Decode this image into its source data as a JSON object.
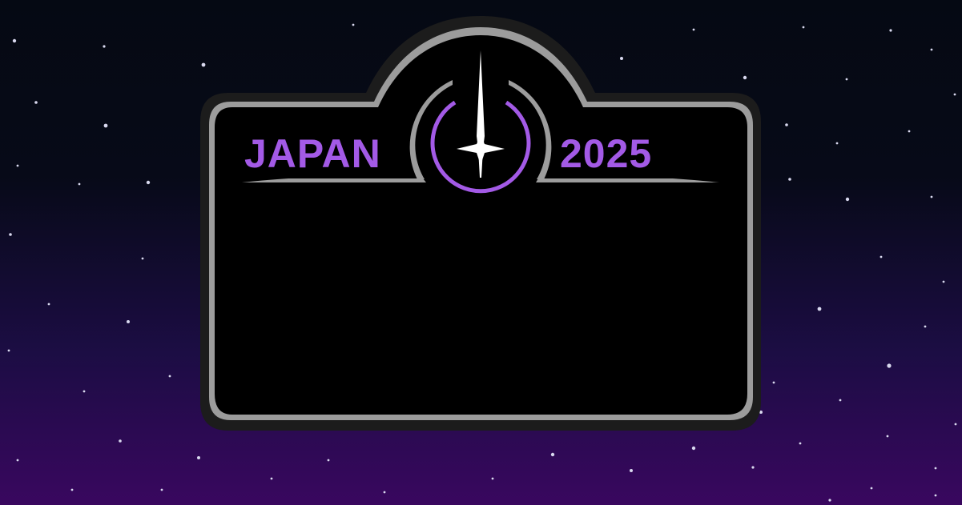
{
  "badge": {
    "left_text": "JAPAN",
    "right_text": "2025",
    "text_color": "#a35ae6",
    "outline_color": "#9c9c9c",
    "fill_color": "#000000",
    "emblem_icon": "star-emblem-icon"
  },
  "background": {
    "top_color": "#050913",
    "bottom_color": "#39075f",
    "star_color": "#d9d9ef"
  }
}
